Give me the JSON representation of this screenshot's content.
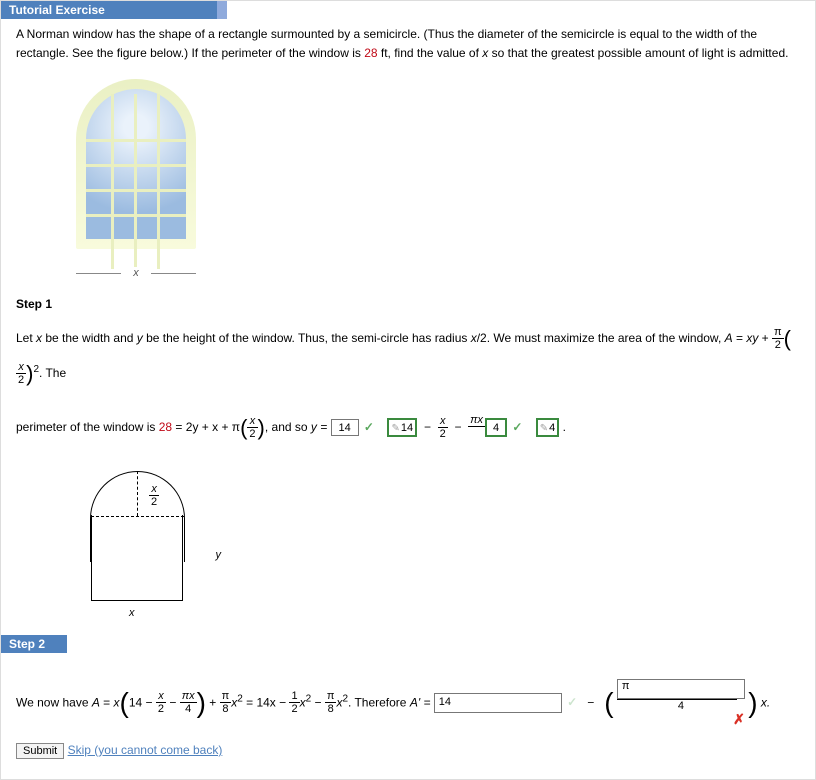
{
  "header": {
    "tutorial": "Tutorial Exercise",
    "step2": "Step 2",
    "step1": "Step 1"
  },
  "problem": {
    "text1": "A Norman window has the shape of a rectangle surmounted by a semicircle. (Thus the diameter of the semicircle is equal to the width of the rectangle. See the figure below.) If the perimeter of the window is ",
    "perimeter": "28",
    "text2": " ft, find the value of ",
    "varx": "x",
    "text3": " so that the greatest possible amount of light is admitted."
  },
  "figure": {
    "xlabel": "x"
  },
  "step1": {
    "p1a": "Let ",
    "x": "x",
    "p1b": " be the width and ",
    "y": "y",
    "p1c": " be the height of the window. Thus, the semi-circle has radius ",
    "rad": "x",
    "p1c2": "/2. We must maximize the area of the window, ",
    "Aeq": "A",
    "p1d": " = ",
    "xy": "xy",
    "half_pi": {
      "num": "π",
      "den": "2"
    },
    "xover2": {
      "num": "x",
      "den": "2"
    },
    "sq": "2",
    "p1e": ". The",
    "p2a": "perimeter of the window is ",
    "per_eq": " = 2y + x + π",
    "per_val": "28",
    "and_so": ", and so ",
    "yeq": "y = ",
    "ans_y_box": "14",
    "ans_14b": "14",
    "minus_x2": {
      "num": "x",
      "den": "2"
    },
    "pix_over": {
      "top": "πx",
      "bot": " "
    },
    "ans_4a": "4",
    "ans_4b": "4",
    "diagram": {
      "r_num": "x",
      "r_den": "2",
      "y": "y",
      "x": "x"
    }
  },
  "step2": {
    "p1a": "We now have ",
    "A": "A",
    "eq": " = ",
    "x": "x",
    "fourteen": "14",
    "x_over_2": {
      "num": "x",
      "den": "2"
    },
    "pix_over_4": {
      "num": "πx",
      "den": "4"
    },
    "pix2_over_8": {
      "num": "π",
      "den": "8"
    },
    "xsq": "x",
    "eq14x": " = 14x − ",
    "half_x2": {
      "num": "1",
      "den": "2"
    },
    "pi8": {
      "num": "π",
      "den": "8"
    },
    "therefore": ". Therefore ",
    "Aprime": "A' = ",
    "wrong1": "14",
    "four": {
      "num": "π",
      "den": "4"
    },
    "tailx": "x."
  },
  "bottom": {
    "submit": "Submit",
    "skip": "Skip (you cannot come back)"
  }
}
